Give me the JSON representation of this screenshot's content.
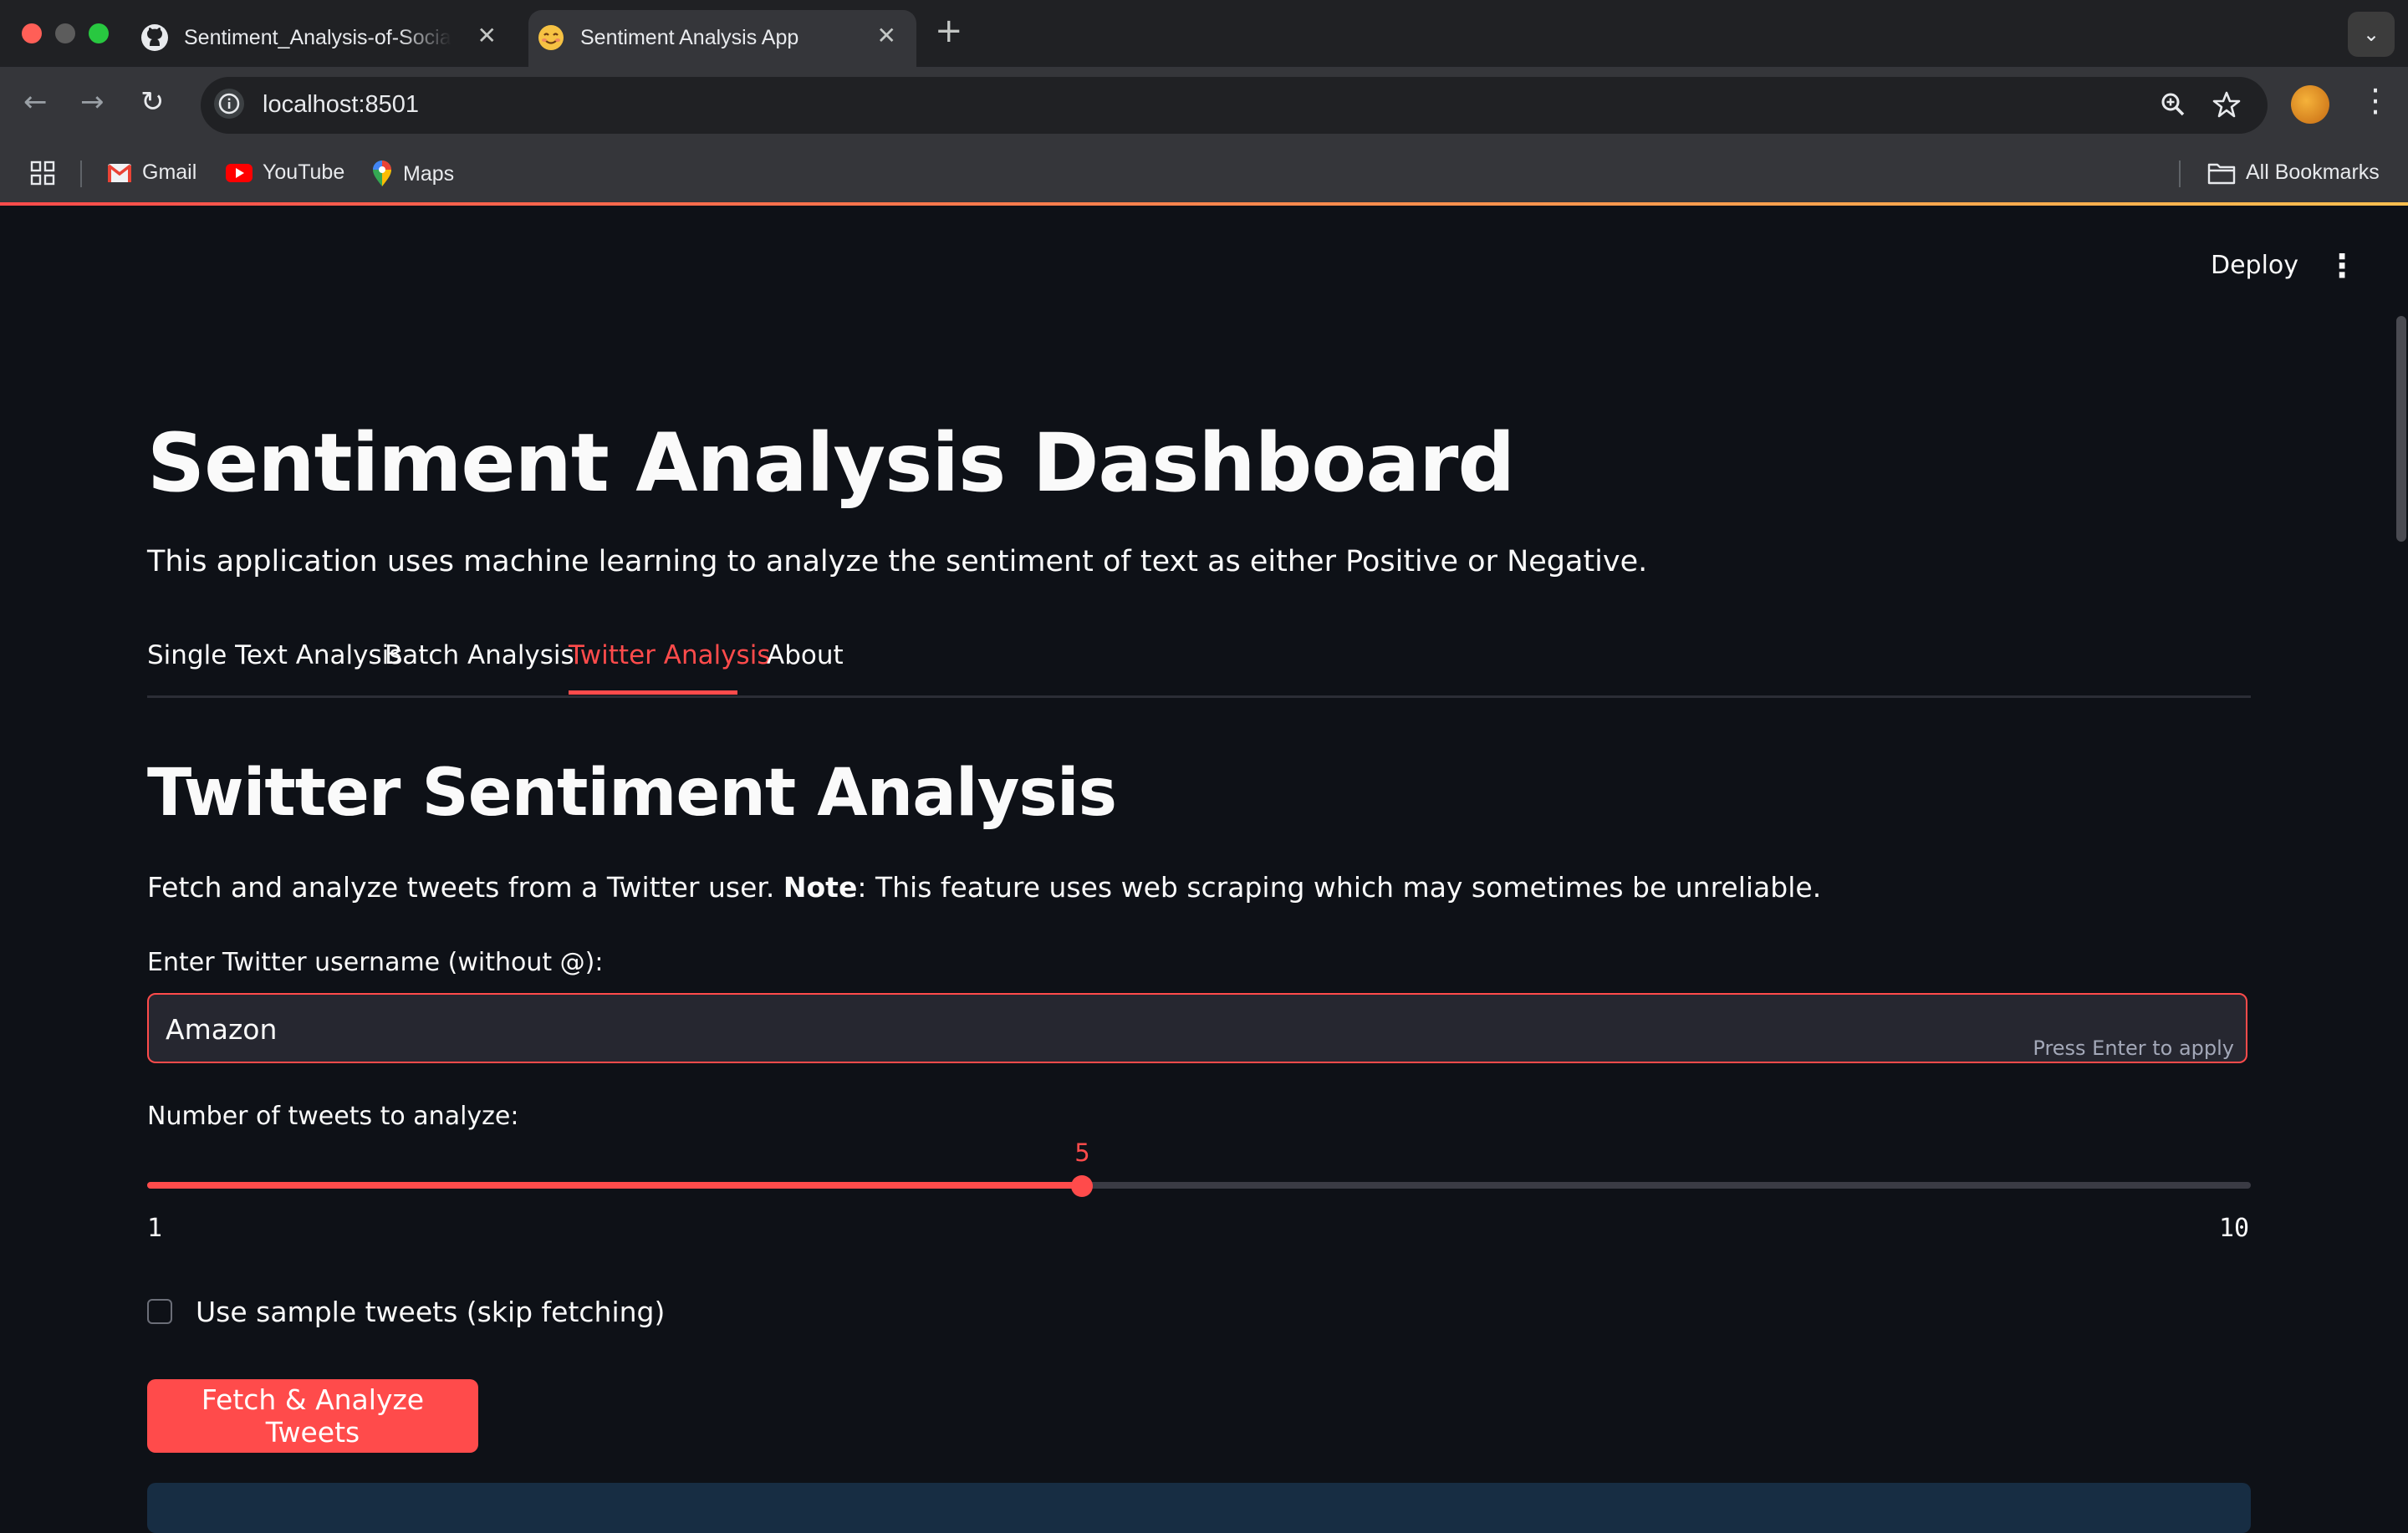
{
  "browser": {
    "tabs": [
      {
        "title": "Sentiment_Analysis-of-Social",
        "icon": "github-icon",
        "active": false
      },
      {
        "title": "Sentiment Analysis App",
        "icon": "smiley-icon",
        "active": true
      }
    ],
    "new_tab": "+",
    "tab_search": "⌄",
    "url": "localhost:8501",
    "bookmarks": [
      {
        "label": "Gmail",
        "icon": "gmail-icon"
      },
      {
        "label": "YouTube",
        "icon": "youtube-icon"
      },
      {
        "label": "Maps",
        "icon": "maps-icon"
      }
    ],
    "all_bookmarks": "All Bookmarks"
  },
  "app_header": {
    "deploy_label": "Deploy",
    "menu_glyph": "⋮"
  },
  "main": {
    "title": "Sentiment Analysis Dashboard",
    "intro": "This application uses machine learning to analyze the sentiment of text as either Positive or Negative.",
    "tabs": [
      {
        "label": "Single Text Analysis",
        "selected": false
      },
      {
        "label": "Batch Analysis",
        "selected": false
      },
      {
        "label": "Twitter Analysis",
        "selected": true
      },
      {
        "label": "About",
        "selected": false
      }
    ],
    "section_title": "Twitter Sentiment Analysis",
    "description_prefix": "Fetch and analyze tweets from a Twitter user. ",
    "description_bold": "Note",
    "description_suffix": ": This feature uses web scraping which may sometimes be unreliable.",
    "username_label": "Enter Twitter username (without @):",
    "username_value": "Amazon",
    "username_hint": "Press Enter to apply",
    "slider_label": "Number of tweets to analyze:",
    "slider_value": "5",
    "slider_min": "1",
    "slider_max": "10",
    "checkbox_label": "Use sample tweets (skip fetching)",
    "checkbox_checked": false,
    "button_label": "Fetch & Analyze Tweets"
  },
  "colors": {
    "accent": "#ff4b4b",
    "background": "#0e1117",
    "input_bg": "#262730",
    "info_bg": "#172d43"
  }
}
